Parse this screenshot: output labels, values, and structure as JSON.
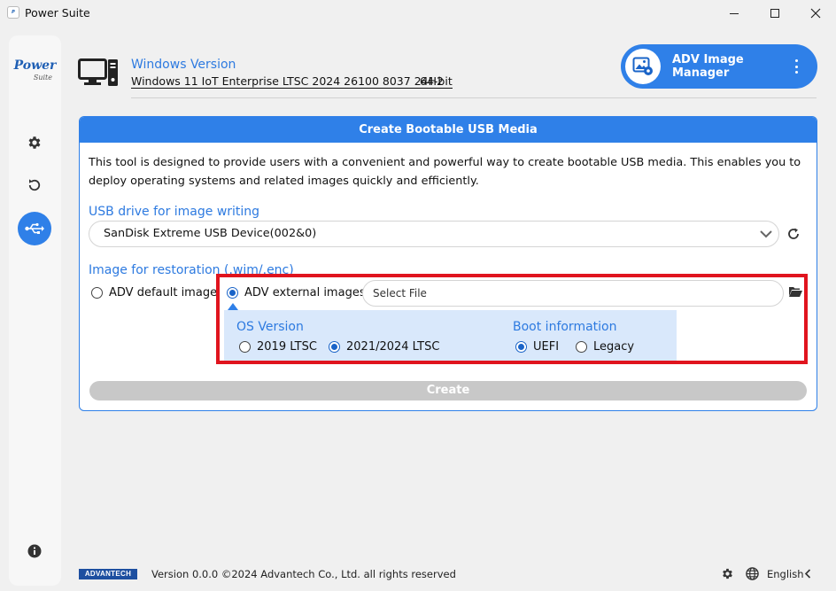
{
  "window": {
    "title": "Power Suite"
  },
  "sidebar": {
    "brand_main": "Power",
    "brand_sub": "Suite",
    "items": [
      {
        "name": "settings",
        "icon": "gear-icon"
      },
      {
        "name": "restore",
        "icon": "history-icon"
      },
      {
        "name": "usb",
        "icon": "usb-icon",
        "active": true
      }
    ],
    "info_icon": "info-icon"
  },
  "header": {
    "windows_version_label": "Windows Version",
    "windows_version_value": "Windows 11 IoT Enterprise LTSC 2024 26100 8037 24H2",
    "bitness": "64-bit",
    "adv_manager_label_line1": "ADV Image",
    "adv_manager_label_line2": "Manager"
  },
  "panel": {
    "title": "Create Bootable USB Media",
    "description": "This tool is designed to provide users with a convenient and powerful way to create bootable USB media. This enables you to deploy operating systems and related images quickly and efficiently.",
    "usb_label": "USB drive for image writing",
    "usb_selected": "SanDisk Extreme USB Device(002&0)",
    "image_label": "Image for restoration (.wim/.enc)",
    "image_options": [
      {
        "label": "ADV default image",
        "selected": false
      },
      {
        "label": "ADV external images",
        "selected": true
      }
    ],
    "file_placeholder": "Select File",
    "os_version_label": "OS Version",
    "os_versions": [
      {
        "label": "2019 LTSC",
        "selected": false
      },
      {
        "label": "2021/2024 LTSC",
        "selected": true
      }
    ],
    "boot_label": "Boot information",
    "boot_options": [
      {
        "label": "UEFI",
        "selected": true
      },
      {
        "label": "Legacy",
        "selected": false
      }
    ],
    "create_label": "Create"
  },
  "footer": {
    "logo_text": "ADVANTECH",
    "version_text": "Version 0.0.0 ©2024 Advantech Co., Ltd. all rights reserved",
    "language": "English"
  },
  "colors": {
    "accent": "#2f80e8",
    "highlight": "#e0141e",
    "subpanel": "#d9e8fb"
  }
}
